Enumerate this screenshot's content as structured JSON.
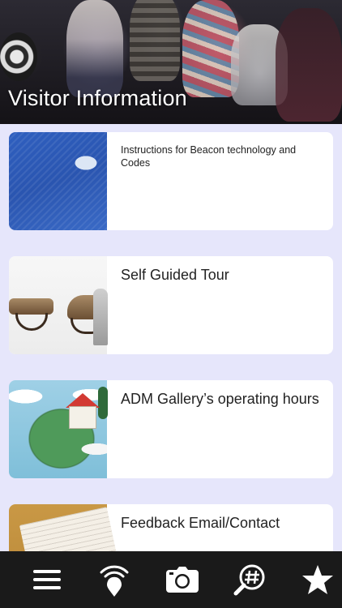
{
  "header": {
    "title": "Visitor Information"
  },
  "items": [
    {
      "label": "Instructions for Beacon technology and Codes",
      "thumbnail_icon": "beacon-cover-image"
    },
    {
      "label": "Self Guided Tour",
      "thumbnail_icon": "benches-image"
    },
    {
      "label": "ADM Gallery’s operating hours",
      "thumbnail_icon": "house-island-image"
    },
    {
      "label": "Feedback Email/Contact",
      "thumbnail_icon": "notebook-image"
    }
  ],
  "tabbar": {
    "tabs": [
      {
        "icon": "menu-icon"
      },
      {
        "icon": "beacon-location-icon"
      },
      {
        "icon": "camera-icon"
      },
      {
        "icon": "hashtag-search-icon"
      },
      {
        "icon": "star-icon"
      }
    ]
  },
  "colors": {
    "background": "#e6e6fb",
    "tabbar": "#1a1a1a",
    "card": "#ffffff",
    "text": "#222222"
  }
}
